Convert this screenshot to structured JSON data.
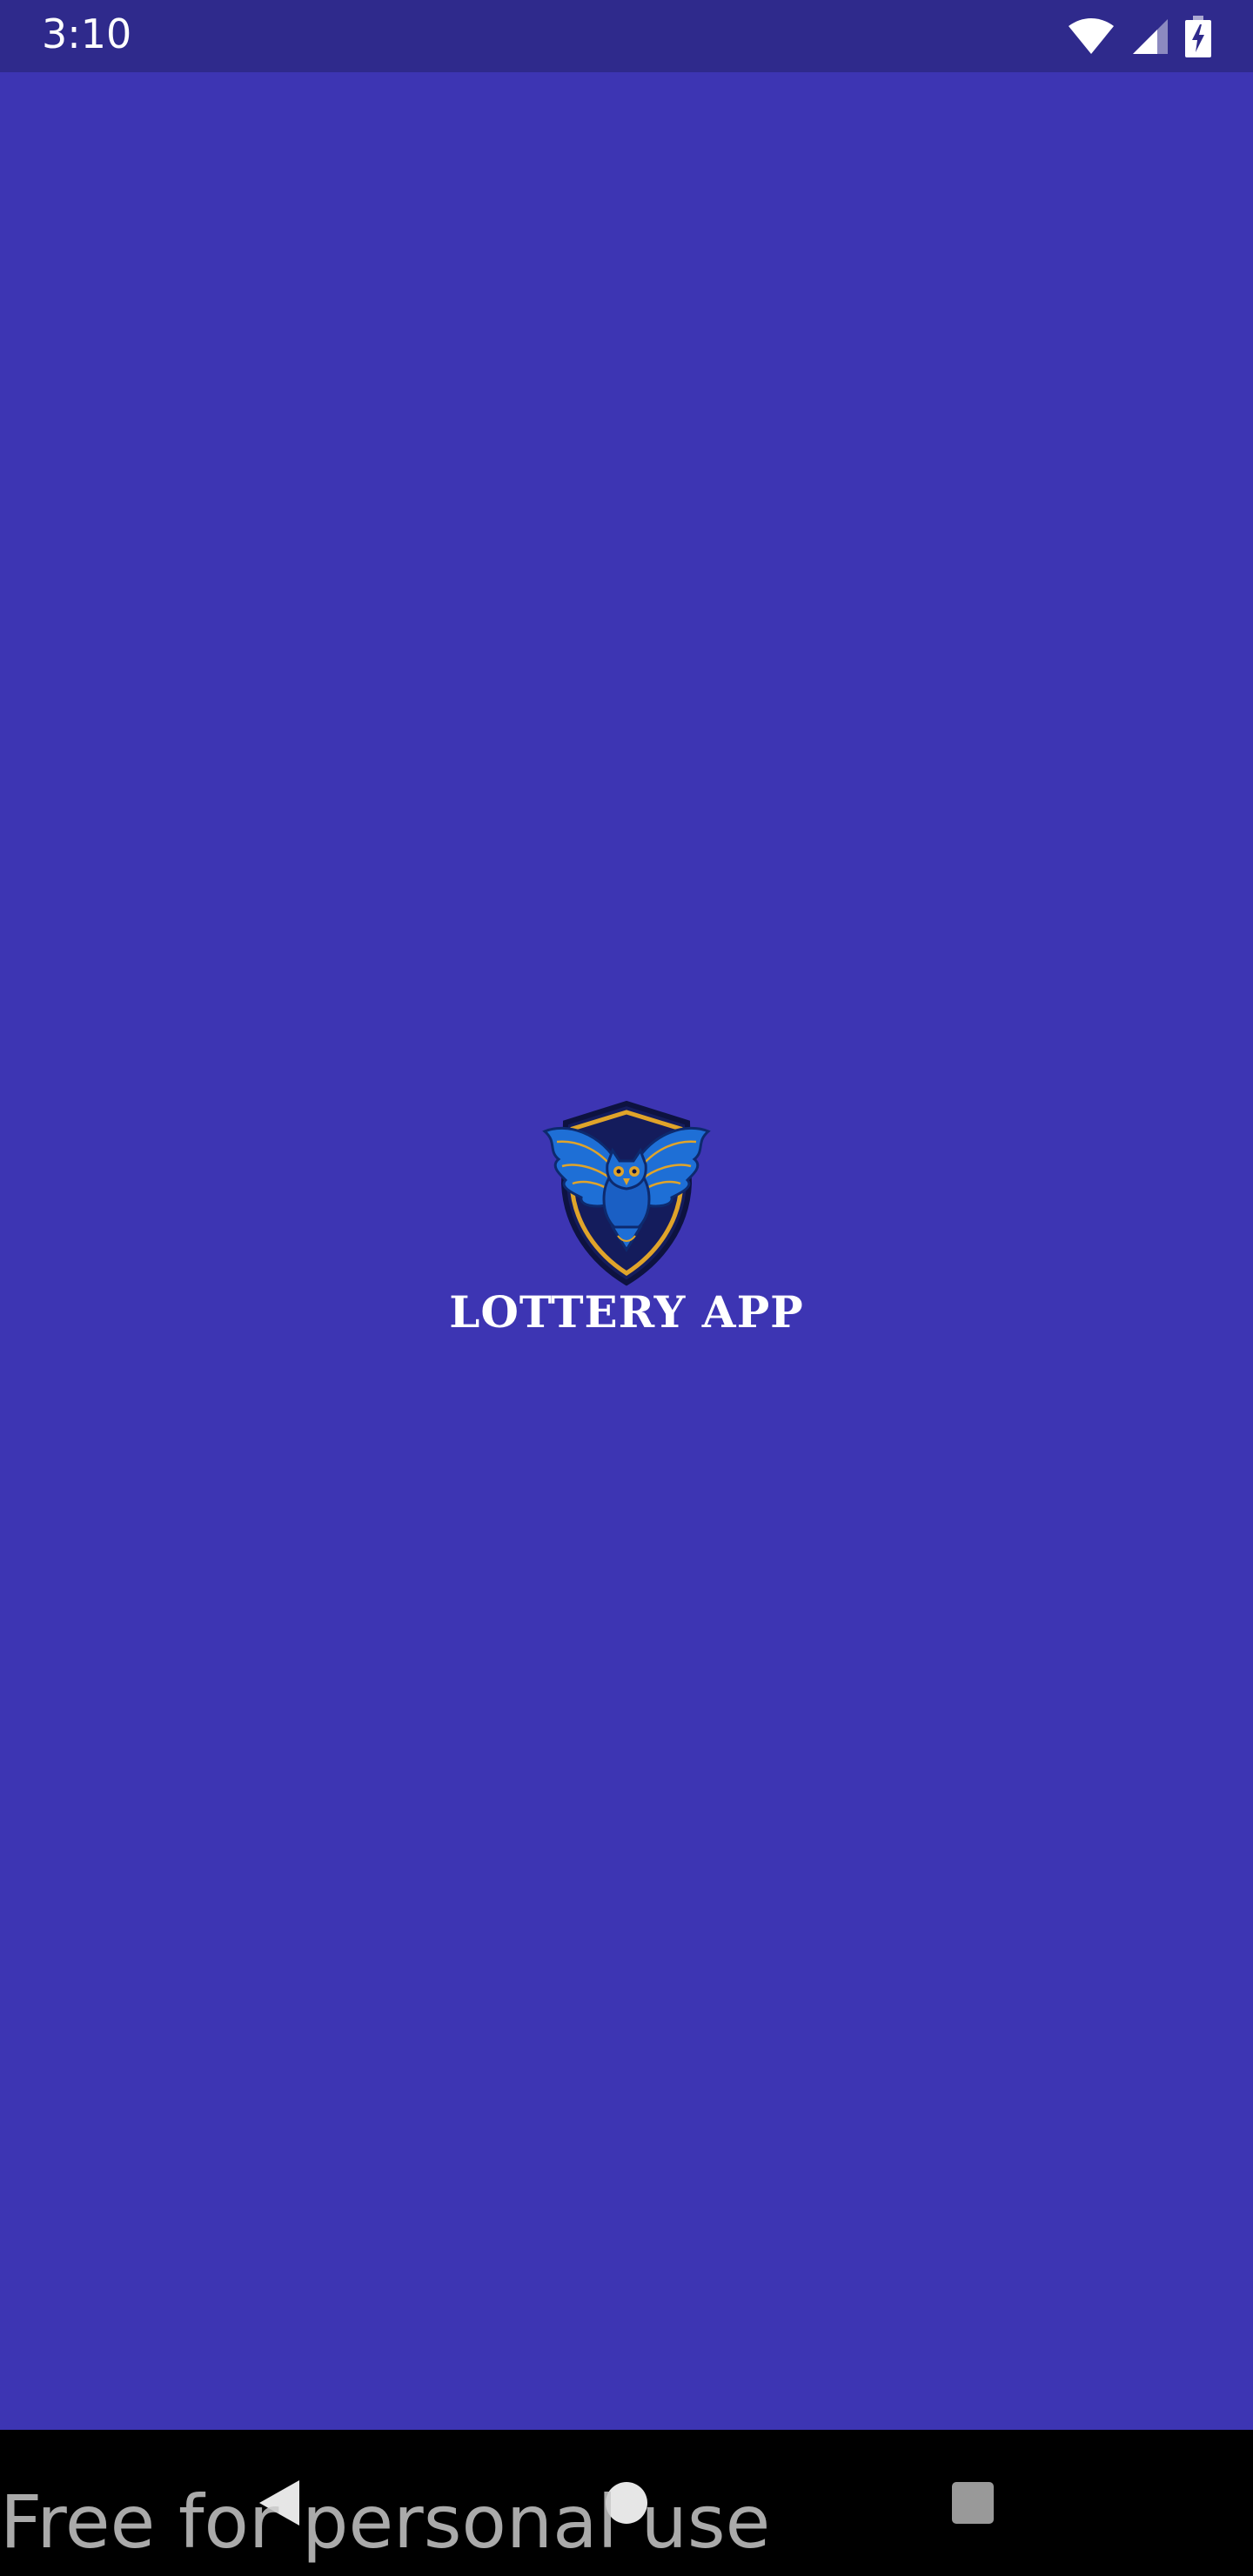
{
  "status_bar": {
    "time": "3:10",
    "icons": [
      "wifi-icon",
      "cell-signal-icon",
      "battery-charging-icon"
    ]
  },
  "splash": {
    "logo": "owl-shield-logo",
    "title": "LOTTERY APP"
  },
  "nav_bar": {
    "buttons": [
      "back-icon",
      "home-icon",
      "recents-icon"
    ]
  },
  "watermark": {
    "text": "Free for personal use"
  },
  "colors": {
    "background": "#3d35b3",
    "status_bar": "#2f2a8c",
    "nav_bar": "#000000",
    "logo_shield": "#141c5c",
    "logo_outline": "#e0a42a",
    "logo_owl": "#1e6fd6"
  }
}
